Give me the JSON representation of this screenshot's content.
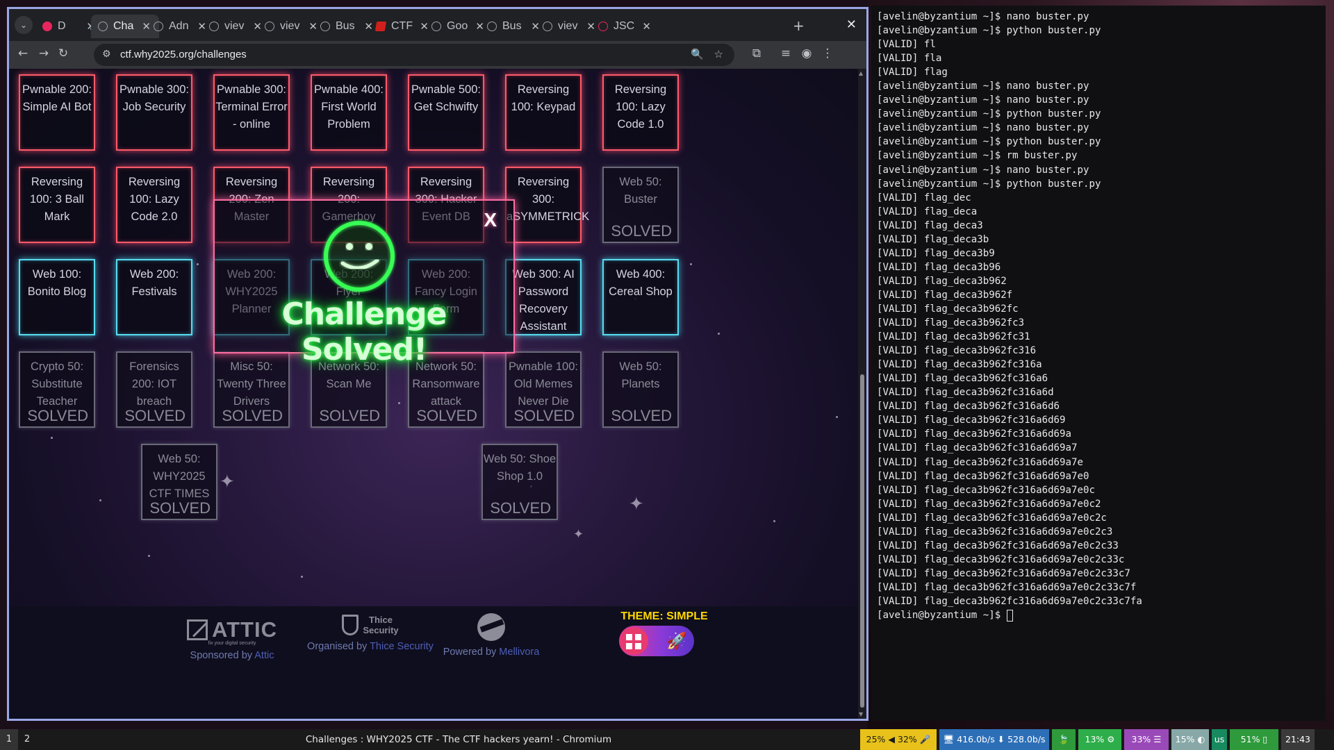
{
  "browser": {
    "tabs": [
      {
        "title": "D",
        "icon": "record-icon",
        "active": false
      },
      {
        "title": "Cha",
        "icon": "ctf-icon",
        "active": true
      },
      {
        "title": "Adn",
        "icon": "globe-icon",
        "active": false
      },
      {
        "title": "viev",
        "icon": "globe-icon",
        "active": false
      },
      {
        "title": "viev",
        "icon": "globe-icon",
        "active": false
      },
      {
        "title": "Bus",
        "icon": "ctf-icon",
        "active": false
      },
      {
        "title": "CTF",
        "icon": "ctf-flag-icon",
        "active": false
      },
      {
        "title": "Goo",
        "icon": "gear-icon",
        "active": false
      },
      {
        "title": "Bus",
        "icon": "ctf-icon",
        "active": false
      },
      {
        "title": "viev",
        "icon": "globe-icon",
        "active": false
      },
      {
        "title": "JSC",
        "icon": "jsc-icon",
        "active": false
      }
    ],
    "url": "ctf.why2025.org/challenges"
  },
  "challenges": [
    {
      "label": "Pwnable 200: Simple AI Bot",
      "state": "red"
    },
    {
      "label": "Pwnable 300: Job Security",
      "state": "red"
    },
    {
      "label": "Pwnable 300: Terminal Error - online",
      "state": "red"
    },
    {
      "label": "Pwnable 400: First World Problem",
      "state": "red"
    },
    {
      "label": "Pwnable 500: Get Schwifty",
      "state": "red"
    },
    {
      "label": "Reversing 100: Keypad",
      "state": "red"
    },
    {
      "label": "Reversing 100: Lazy Code 1.0",
      "state": "red"
    },
    {
      "label": "Reversing 100: 3 Ball Mark",
      "state": "red"
    },
    {
      "label": "Reversing 100: Lazy Code 2.0",
      "state": "red"
    },
    {
      "label": "Reversing 200: Zen Master",
      "state": "red"
    },
    {
      "label": "Reversing 200: Gamerboy",
      "state": "red"
    },
    {
      "label": "Reversing 300: Hacker Event DB",
      "state": "red"
    },
    {
      "label": "Reversing 300: aSYMMETRICK",
      "state": "red"
    },
    {
      "label": "Web 50: Buster",
      "state": "solved"
    },
    {
      "label": "Web 100: Bonito Blog",
      "state": "cyan"
    },
    {
      "label": "Web 200: Festivals",
      "state": "cyan"
    },
    {
      "label": "Web 200: WHY2025 Planner",
      "state": "cyan"
    },
    {
      "label": "Web 200: Flyer",
      "state": "cyan"
    },
    {
      "label": "Web 200: Fancy Login Form",
      "state": "cyan"
    },
    {
      "label": "Web 300: AI Password Recovery Assistant",
      "state": "cyan"
    },
    {
      "label": "Web 400: Cereal Shop",
      "state": "cyan"
    },
    {
      "label": "Crypto 50: Substitute Teacher",
      "state": "solved"
    },
    {
      "label": "Forensics 200: IOT breach",
      "state": "solved"
    },
    {
      "label": "Misc 50: Twenty Three Drivers",
      "state": "solved"
    },
    {
      "label": "Network 50: Scan Me",
      "state": "solved"
    },
    {
      "label": "Network 50: Ransomware attack",
      "state": "solved"
    },
    {
      "label": "Pwnable 100: Old Memes Never Die",
      "state": "solved"
    },
    {
      "label": "Web 50: Planets",
      "state": "solved"
    },
    {
      "label": "Web 50: WHY2025 CTF TIMES",
      "state": "solved"
    },
    {
      "label": "Web 50: Shoe Shop 1.0",
      "state": "solved"
    }
  ],
  "solved_label": "SOLVED",
  "modal": {
    "title": "Challenge Solved!",
    "close": "X"
  },
  "footer": {
    "sponsor_prefix": "Sponsored by ",
    "sponsor_link": "Attic",
    "attic_logo": "ATTIC",
    "attic_tagline": "fix your digital security",
    "organiser_prefix": "Organised by ",
    "organiser_link": "Thice Security",
    "thice_logo_1": "Thice",
    "thice_logo_2": "Security",
    "powered_prefix": "Powered by ",
    "powered_link": "Mellivora",
    "theme_label": "THEME: SIMPLE"
  },
  "terminal": {
    "lines": [
      "[avelin@byzantium ~]$ nano buster.py",
      "[avelin@byzantium ~]$ python buster.py",
      "[VALID] fl",
      "[VALID] fla",
      "[VALID] flag",
      "[avelin@byzantium ~]$ nano buster.py",
      "[avelin@byzantium ~]$ nano buster.py",
      "[avelin@byzantium ~]$ python buster.py",
      "[avelin@byzantium ~]$ nano buster.py",
      "[avelin@byzantium ~]$ python buster.py",
      "[avelin@byzantium ~]$ rm buster.py",
      "[avelin@byzantium ~]$ nano buster.py",
      "[avelin@byzantium ~]$ python buster.py",
      "[VALID] flag_dec",
      "[VALID] flag_deca",
      "[VALID] flag_deca3",
      "[VALID] flag_deca3b",
      "[VALID] flag_deca3b9",
      "[VALID] flag_deca3b96",
      "[VALID] flag_deca3b962",
      "[VALID] flag_deca3b962f",
      "[VALID] flag_deca3b962fc",
      "[VALID] flag_deca3b962fc3",
      "[VALID] flag_deca3b962fc31",
      "[VALID] flag_deca3b962fc316",
      "[VALID] flag_deca3b962fc316a",
      "[VALID] flag_deca3b962fc316a6",
      "[VALID] flag_deca3b962fc316a6d",
      "[VALID] flag_deca3b962fc316a6d6",
      "[VALID] flag_deca3b962fc316a6d69",
      "[VALID] flag_deca3b962fc316a6d69a",
      "[VALID] flag_deca3b962fc316a6d69a7",
      "[VALID] flag_deca3b962fc316a6d69a7e",
      "[VALID] flag_deca3b962fc316a6d69a7e0",
      "[VALID] flag_deca3b962fc316a6d69a7e0c",
      "[VALID] flag_deca3b962fc316a6d69a7e0c2",
      "[VALID] flag_deca3b962fc316a6d69a7e0c2c",
      "[VALID] flag_deca3b962fc316a6d69a7e0c2c3",
      "[VALID] flag_deca3b962fc316a6d69a7e0c2c33",
      "[VALID] flag_deca3b962fc316a6d69a7e0c2c33c",
      "[VALID] flag_deca3b962fc316a6d69a7e0c2c33c7",
      "[VALID] flag_deca3b962fc316a6d69a7e0c2c33c7f",
      "[VALID] flag_deca3b962fc316a6d69a7e0c2c33c7fa"
    ],
    "prompt": "[avelin@byzantium ~]$ "
  },
  "statusbar": {
    "workspaces": [
      "1",
      "2"
    ],
    "window_title": "Challenges : WHY2025 CTF - The CTF hackers yearn! - Chromium",
    "blocks": [
      {
        "text": "25% ◀ 32% 🎤",
        "color": "#e8c21a",
        "fg": "#1a1a1a"
      },
      {
        "text": "🖥 416.0b/s ⬇ 528.0b/s ⬆",
        "color": "#2d6fb7",
        "fg": "#ffffff"
      },
      {
        "text": "🍃",
        "color": "#2e9a3c",
        "fg": "#ffffff"
      },
      {
        "text": "13% ⚙",
        "color": "#2eae4a",
        "fg": "#ffffff"
      },
      {
        "text": "33% ☰",
        "color": "#9a4ab8",
        "fg": "#ffffff"
      },
      {
        "text": "15% ◐",
        "color": "#88a8a8",
        "fg": "#ffffff"
      },
      {
        "text": "us",
        "color": "#178a60",
        "fg": "#ffffff"
      },
      {
        "text": "51% ▯",
        "color": "#2e9a3c",
        "fg": "#ffffff"
      },
      {
        "text": "21:43",
        "color": "#3a3a3a",
        "fg": "#ffffff"
      }
    ]
  }
}
